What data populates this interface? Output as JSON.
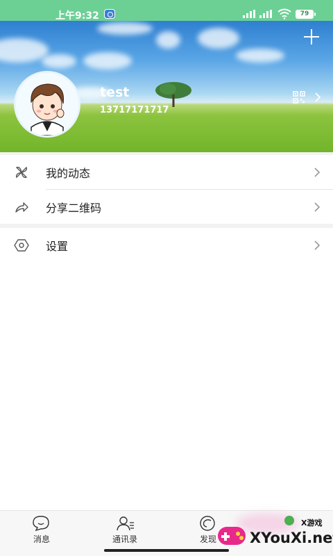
{
  "status_bar": {
    "time": "上午9:32",
    "battery": "79"
  },
  "profile": {
    "username": "test",
    "phone": "13717171717"
  },
  "menu": {
    "moments": "我的动态",
    "share_qr": "分享二维码",
    "settings": "设置"
  },
  "bottom_nav": {
    "tabs": [
      "消息",
      "通讯录",
      "发现"
    ]
  },
  "watermark": {
    "brand": "XYouXi.net",
    "small": "X游戏"
  },
  "colors": {
    "status_bar": "#6cd095",
    "accent_green": "#72b52a"
  }
}
